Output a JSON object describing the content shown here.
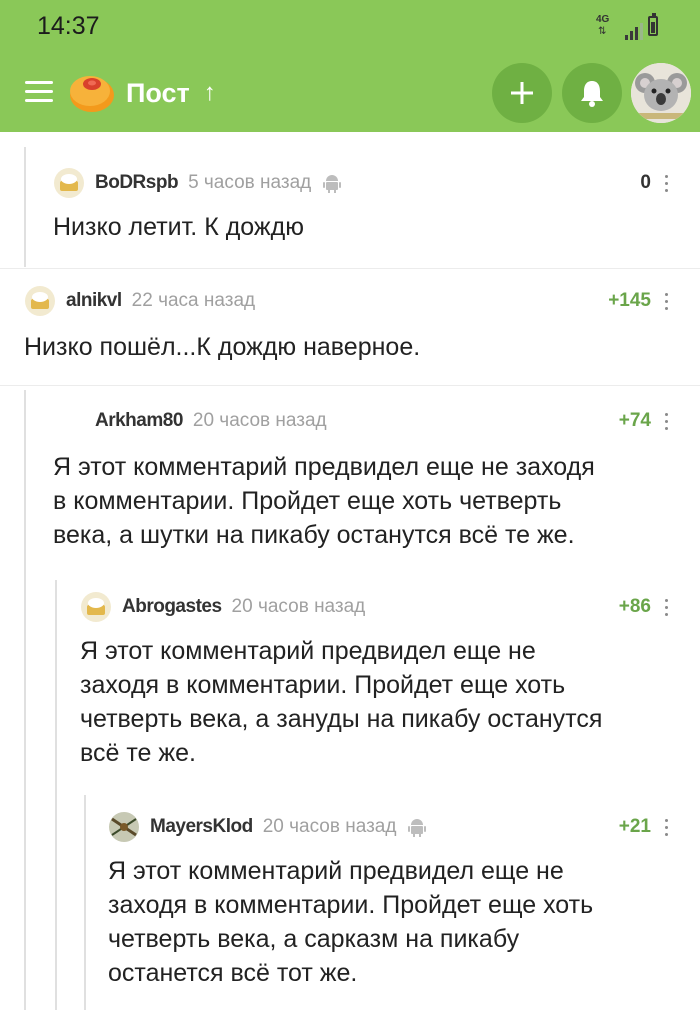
{
  "status_bar": {
    "time": "14:37",
    "network": "4G"
  },
  "header": {
    "title": "Пост"
  },
  "colors": {
    "header_bg": "#8ac858",
    "positive_rating": "#6aa54a"
  },
  "comments": [
    {
      "user": "BoDRspb",
      "time": "5 часов назад",
      "rating": "0",
      "lines": [
        "Низко летит. К дождю"
      ]
    },
    {
      "user": "alnikvl",
      "time": "22 часа назад",
      "rating": "+145",
      "lines": [
        "Низко пошёл...К дождю наверное."
      ]
    },
    {
      "user": "Arkham80",
      "time": "20 часов назад",
      "rating": "+74",
      "lines": [
        "Я этот комментарий предвидел еще не заходя",
        "в комментарии. Пройдет еще хоть четверть",
        "века, а шутки на пикабу останутся всё те же."
      ]
    },
    {
      "user": "Abrogastes",
      "time": "20 часов назад",
      "rating": "+86",
      "lines": [
        "Я этот комментарий предвидел еще не",
        "заходя в комментарии. Пройдет еще хоть",
        "четверть века, а зануды на пикабу останутся",
        "всё те же."
      ]
    },
    {
      "user": "MayersKlod",
      "time": "20 часов назад",
      "rating": "+21",
      "lines": [
        "Я этот комментарий предвидел еще не",
        "заходя в комментарии. Пройдет еще хоть",
        "четверть века, а сарказм на пикабу",
        "останется всё тот же."
      ]
    }
  ]
}
